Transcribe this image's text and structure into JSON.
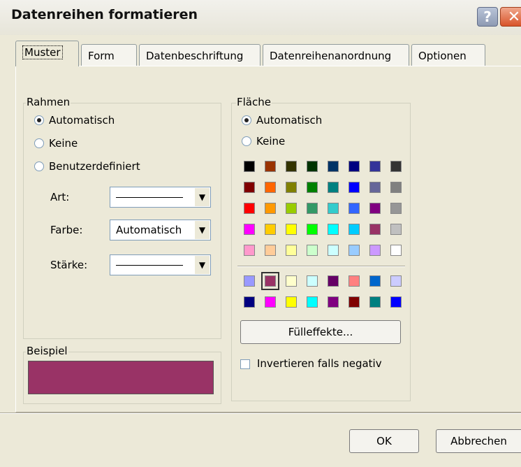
{
  "window": {
    "title": "Datenreihen formatieren",
    "help_label": "?",
    "close_label": "✕"
  },
  "tabs": [
    "Muster",
    "Form",
    "Datenbeschriftung",
    "Datenreihenanordnung",
    "Optionen"
  ],
  "rahmen": {
    "legend": "Rahmen",
    "options": [
      "Automatisch",
      "Keine",
      "Benutzerdefiniert"
    ],
    "selected": "Automatisch",
    "art_label": "Art:",
    "farbe_label": "Farbe:",
    "farbe_value": "Automatisch",
    "staerke_label": "Stärke:"
  },
  "beispiel": {
    "legend": "Beispiel",
    "color": "#993366"
  },
  "flaeche": {
    "legend": "Fläche",
    "options": [
      "Automatisch",
      "Keine"
    ],
    "selected": "Automatisch",
    "palette_main": [
      [
        "#000000",
        "#993300",
        "#333300",
        "#003300",
        "#003366",
        "#000080",
        "#333399",
        "#333333"
      ],
      [
        "#800000",
        "#FF6600",
        "#808000",
        "#008000",
        "#008080",
        "#0000FF",
        "#666699",
        "#808080"
      ],
      [
        "#FF0000",
        "#FF9900",
        "#99CC00",
        "#339966",
        "#33CCCC",
        "#3366FF",
        "#800080",
        "#969696"
      ],
      [
        "#FF00FF",
        "#FFCC00",
        "#FFFF00",
        "#00FF00",
        "#00FFFF",
        "#00CCFF",
        "#993366",
        "#C0C0C0"
      ],
      [
        "#FF99CC",
        "#FFCC99",
        "#FFFF99",
        "#CCFFCC",
        "#CCFFFF",
        "#99CCFF",
        "#CC99FF",
        "#FFFFFF"
      ]
    ],
    "palette_chart": [
      [
        "#9999FF",
        "#993366",
        "#FFFFCC",
        "#CCFFFF",
        "#660066",
        "#FF8080",
        "#0066CC",
        "#CCCCFF"
      ],
      [
        "#000080",
        "#FF00FF",
        "#FFFF00",
        "#00FFFF",
        "#800080",
        "#800000",
        "#008080",
        "#0000FF"
      ]
    ],
    "selected_color": "#993366",
    "fill_effects_label": "Fülleffekte...",
    "invert_label": "Invertieren falls negativ"
  },
  "footer": {
    "ok_label": "OK",
    "cancel_label": "Abbrechen"
  }
}
